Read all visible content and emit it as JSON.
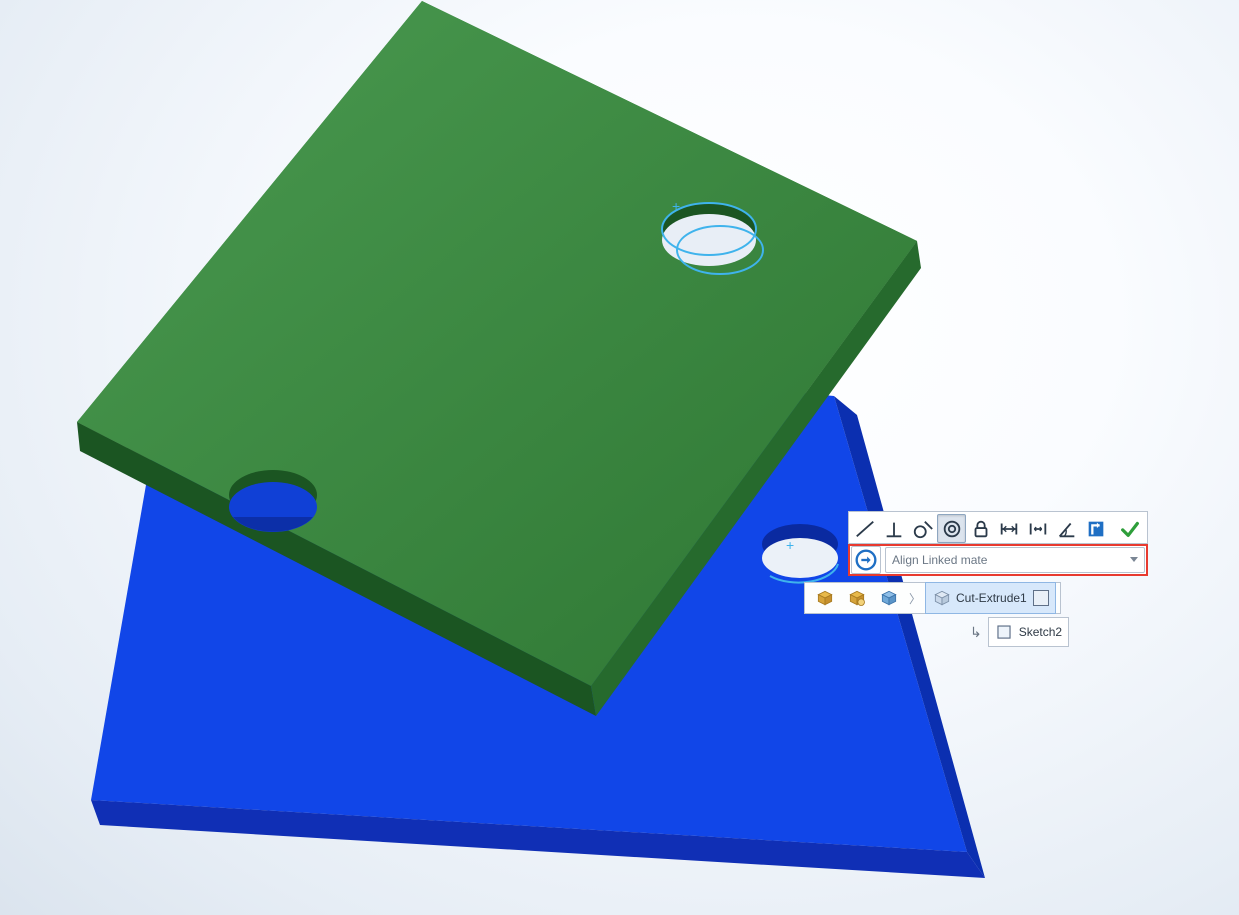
{
  "scene": {
    "parts": [
      {
        "name": "blue-plate",
        "color": "#1641e0",
        "top_shade": "#1146e8",
        "edge_shade": "#0b2fb0"
      },
      {
        "name": "green-plate",
        "color": "#2f7a33",
        "top_shade": "#35803a",
        "edge_shade": "#1e5724"
      }
    ],
    "selected_hole": {
      "center_mark": "+"
    }
  },
  "mate_toolbar": {
    "buttons": [
      {
        "name": "coincident",
        "selected": false
      },
      {
        "name": "perpendicular",
        "selected": false
      },
      {
        "name": "tangent",
        "selected": false
      },
      {
        "name": "concentric",
        "selected": true
      },
      {
        "name": "lock",
        "selected": false
      },
      {
        "name": "distance",
        "selected": false
      },
      {
        "name": "width",
        "selected": false
      },
      {
        "name": "angle",
        "selected": false
      },
      {
        "name": "anti-align",
        "selected": false
      }
    ],
    "confirm": {
      "name": "ok"
    }
  },
  "mate_dropdown": {
    "alignment_button": {
      "name": "alignment-toggle"
    },
    "placeholder": "Align Linked mate"
  },
  "breadcrumb": {
    "items": [
      {
        "name": "assembly",
        "icon": "assembly-icon",
        "label": ""
      },
      {
        "name": "subassembly",
        "icon": "subassembly-icon",
        "label": ""
      },
      {
        "name": "part",
        "icon": "part-icon",
        "label": ""
      },
      {
        "name": "feature",
        "icon": "feature-icon",
        "label": "Cut-Extrude1",
        "selected": true,
        "trailing_square": true
      }
    ]
  },
  "child_item": {
    "icon": "sketch-icon",
    "label": "Sketch2"
  }
}
